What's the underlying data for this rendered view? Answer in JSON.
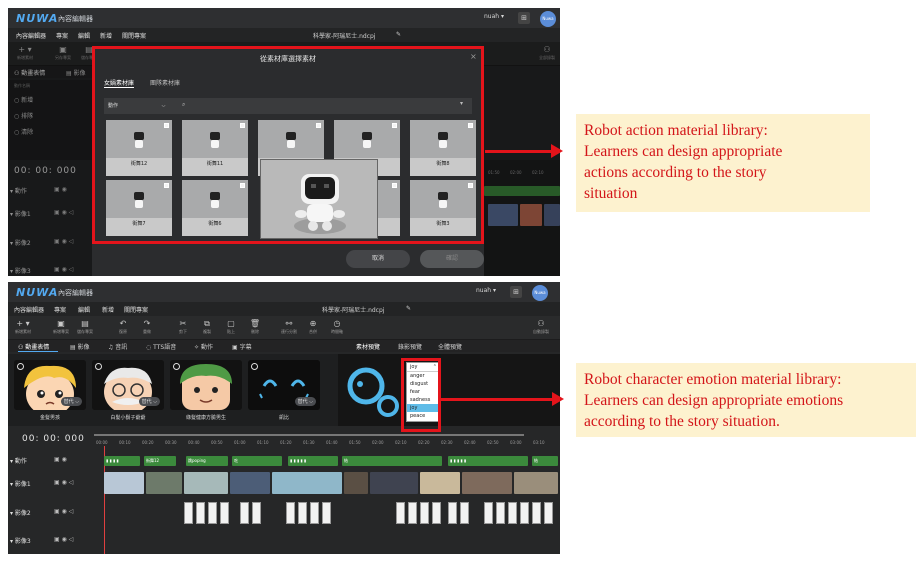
{
  "screen1": {
    "logo": "NUWA",
    "logo_sub": "內容編輯器",
    "user": "nuah ▾",
    "avatar": "Nuwa",
    "menu": [
      "內容編輯器",
      "專案",
      "編輯",
      "新增",
      "關閉專案"
    ],
    "project_name": "科學家-阿瑞尼士.ndcpj",
    "tools": [
      {
        "label": "新增素材"
      },
      {
        "label": "另存專案"
      },
      {
        "label": "儲存專案"
      }
    ],
    "right_tool": "全部錄製",
    "tabs": [
      "動畫表情",
      "影像"
    ],
    "panel_header": "動作名稱",
    "side_items": [
      "新增",
      "排隊",
      "清除"
    ],
    "time": "00: 00: 000",
    "tracks": [
      "動作",
      "影像1",
      "影像2",
      "影像3"
    ],
    "ruler": [
      "01:50",
      "02:00",
      "02:10"
    ],
    "modal": {
      "title": "從素材庫選擇素材",
      "close": "×",
      "tabs": [
        "女媧素材庫",
        "團隊素材庫"
      ],
      "category": "動作",
      "search_icon": "search-icon",
      "items": [
        "街舞12",
        "街舞11",
        "",
        "",
        "街舞8",
        "街舞7",
        "街舞6",
        "",
        "",
        "街舞3"
      ],
      "cancel": "取消",
      "confirm": "確認"
    }
  },
  "screen2": {
    "logo": "NUWA",
    "logo_sub": "內容編輯器",
    "user": "nuah ▾",
    "avatar": "Nuwa",
    "menu": [
      "內容編輯器",
      "專案",
      "編輯",
      "新增",
      "關閉專案"
    ],
    "project_name": "科學家-阿瑞尼士.ndcpj",
    "tools": [
      {
        "label": "新增素材"
      },
      {
        "label": "新增專案"
      },
      {
        "label": "儲存專案"
      },
      {
        "label": "復原"
      },
      {
        "label": "重做"
      },
      {
        "label": "剪下"
      },
      {
        "label": "複製"
      },
      {
        "label": "貼上"
      },
      {
        "label": "刪除"
      },
      {
        "label": "連行分割"
      },
      {
        "label": "合併"
      },
      {
        "label": "時間軸"
      }
    ],
    "right_tool": "自動錄製",
    "tabs": [
      "動畫表情",
      "影像",
      "音訊",
      "TTS語音",
      "動作",
      "字幕"
    ],
    "preview_tabs": [
      "素材預覽",
      "錄影預覽",
      "全體預覽"
    ],
    "cards": [
      {
        "label": "金髮男孩",
        "swap": ""
      },
      {
        "label": "白髮小鬍子爺爺",
        "swap": "替代 ⌵"
      },
      {
        "label": "綠髮健康方臉男生",
        "swap": ""
      },
      {
        "label": "凱比",
        "swap": "替代 ⌵"
      }
    ],
    "card0_swap": "替代 ⌵",
    "emotion_dropdown": {
      "selected": "joy",
      "options": [
        "anger",
        "disgust",
        "fear",
        "sadness",
        "joy",
        "peace"
      ]
    },
    "time": "00: 00: 000",
    "ruler": [
      "00:00",
      "00:10",
      "00:20",
      "00:30",
      "00:40",
      "00:50",
      "01:00",
      "01:10",
      "01:20",
      "01:30",
      "01:40",
      "01:50",
      "02:00",
      "02:10",
      "02:20",
      "02:30",
      "02:40",
      "02:50",
      "03:00",
      "03:10"
    ],
    "tracks": [
      "動作",
      "影像1",
      "影像2",
      "影像3"
    ],
    "clips": [
      "街舞12",
      "跳poping",
      "吃",
      "結",
      "結"
    ]
  },
  "annotations": [
    {
      "lines": [
        "Robot action material library:",
        "Learners can design appropriate",
        "actions according to the story",
        "situation"
      ]
    },
    {
      "lines": [
        "Robot character emotion material library:",
        "Learners can design appropriate emotions",
        "according to the story situation."
      ]
    }
  ],
  "colors": {
    "accent": "#53a9f0",
    "highlight": "#e4141b",
    "note_bg": "#fdf2cf",
    "clip_green": "#3b8a3c"
  }
}
